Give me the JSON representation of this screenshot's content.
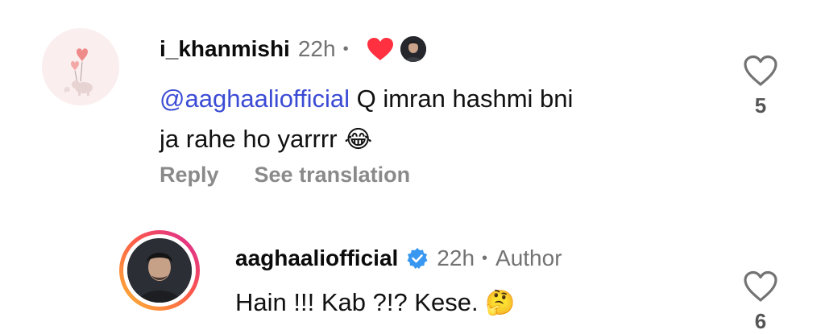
{
  "comments": [
    {
      "username": "i_khanmishi",
      "time": "22h",
      "separator": "•",
      "liked_by_author_icon": "red-heart-icon",
      "mention": "@aaghaaliofficial",
      "text_line1": " Q imran hashmi bni",
      "text_line2": "ja rahe ho yarrrr ",
      "emoji": "😂",
      "reply_label": "Reply",
      "translate_label": "See translation",
      "like_count": "5",
      "heart_color": "#ff3040"
    },
    {
      "username": "aaghaaliofficial",
      "verified": true,
      "time": "22h",
      "separator": "•",
      "badge": "Author",
      "text": "Hain !!! Kab ?!? Kese. ",
      "emoji": "🤔",
      "like_count": "6"
    }
  ],
  "colors": {
    "mention": "#3b4bd4",
    "secondary_text": "#737373",
    "verified_blue": "#3897f0"
  }
}
